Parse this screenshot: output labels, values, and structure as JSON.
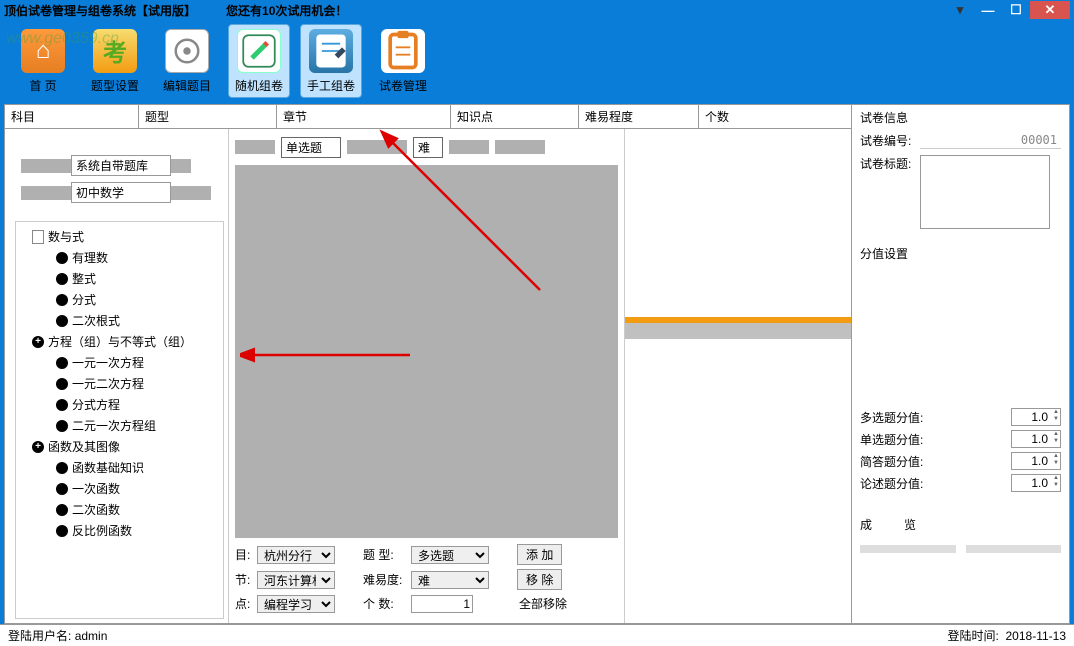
{
  "window": {
    "title": "顶伯试卷管理与组卷系统【试用版】",
    "trial_msg": "您还有10次试用机会！"
  },
  "toolbar": [
    {
      "label": "首 页",
      "icon": "home"
    },
    {
      "label": "题型设置",
      "icon": "type"
    },
    {
      "label": "编辑题目",
      "icon": "edit"
    },
    {
      "label": "随机组卷",
      "icon": "rand",
      "active": true
    },
    {
      "label": "手工组卷",
      "icon": "manual",
      "active": true
    },
    {
      "label": "试卷管理",
      "icon": "manage"
    }
  ],
  "columns": {
    "subject": "科目",
    "qtype": "题型",
    "chapter": "章节",
    "kpoint": "知识点",
    "difficulty": "难易程度",
    "count": "个数"
  },
  "selectors": {
    "bank": "系统自带题库",
    "subject": "初中数学"
  },
  "tree": [
    {
      "t": "数与式",
      "lvl": 1,
      "kind": "doc"
    },
    {
      "t": "有理数",
      "lvl": 2,
      "kind": "dot"
    },
    {
      "t": "整式",
      "lvl": 2,
      "kind": "dot"
    },
    {
      "t": "分式",
      "lvl": 2,
      "kind": "dot"
    },
    {
      "t": "二次根式",
      "lvl": 2,
      "kind": "dot"
    },
    {
      "t": "方程（组）与不等式（组）",
      "lvl": 1,
      "kind": "plus"
    },
    {
      "t": "一元一次方程",
      "lvl": 2,
      "kind": "dot"
    },
    {
      "t": "一元二次方程",
      "lvl": 2,
      "kind": "dot"
    },
    {
      "t": "分式方程",
      "lvl": 2,
      "kind": "dot"
    },
    {
      "t": "二元一次方程组",
      "lvl": 2,
      "kind": "dot"
    },
    {
      "t": "函数及其图像",
      "lvl": 1,
      "kind": "plus"
    },
    {
      "t": "函数基础知识",
      "lvl": 2,
      "kind": "dot"
    },
    {
      "t": "一次函数",
      "lvl": 2,
      "kind": "dot"
    },
    {
      "t": "二次函数",
      "lvl": 2,
      "kind": "dot"
    },
    {
      "t": "反比例函数",
      "lvl": 2,
      "kind": "dot"
    }
  ],
  "midtop": {
    "qtype_value": "单选题",
    "diff_value": "难"
  },
  "midform": {
    "r1": {
      "lab1": "目:",
      "v1": "杭州分行",
      "lab2": "题   型:",
      "v2": "多选题",
      "btn": "添     加"
    },
    "r2": {
      "lab1": "节:",
      "v1": "河东计算机考",
      "lab2": "难易度:",
      "v2": "难",
      "btn": "移     除"
    },
    "r3": {
      "lab1": "点:",
      "v1": "编程学习",
      "lab2": "个   数:",
      "v2": "1",
      "btn": "全部移除"
    }
  },
  "right": {
    "info_title": "试卷信息",
    "id_label": "试卷编号:",
    "id_value": "00001",
    "title_label": "试卷标题:",
    "score_title": "分值设置",
    "scores": [
      {
        "label": "多选题分值:",
        "value": "1.0"
      },
      {
        "label": "单选题分值:",
        "value": "1.0"
      },
      {
        "label": "简答题分值:",
        "value": "1.0"
      },
      {
        "label": "论述题分值:",
        "value": "1.0"
      }
    ],
    "bot_labels": {
      "a": "成",
      "b": "览"
    }
  },
  "status": {
    "user_label": "登陆用户名:",
    "user": "admin",
    "time_label": "登陆时间:",
    "time": "2018-11-13"
  },
  "watermark": "www.ge0359.cn"
}
